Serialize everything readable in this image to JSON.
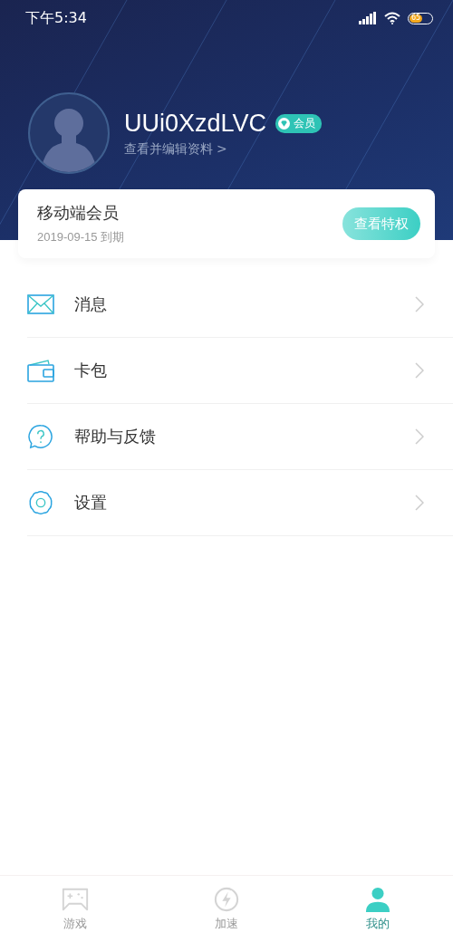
{
  "status_bar": {
    "time": "下午5:34",
    "battery": "65"
  },
  "profile": {
    "username": "UUi0XzdLVC",
    "badge": "会员",
    "edit_link": "查看并编辑资料",
    "edit_chevron": ">"
  },
  "membership_card": {
    "title": "移动端会员",
    "expiry": "2019-09-15 到期",
    "button": "查看特权"
  },
  "menu": [
    {
      "kind": "mail",
      "label": "消息"
    },
    {
      "kind": "wallet",
      "label": "卡包"
    },
    {
      "kind": "help",
      "label": "帮助与反馈"
    },
    {
      "kind": "settings",
      "label": "设置"
    }
  ],
  "tabs": [
    {
      "kind": "games",
      "label": "游戏",
      "selected": false
    },
    {
      "kind": "boost",
      "label": "加速",
      "selected": false
    },
    {
      "kind": "profile",
      "label": "我的",
      "selected": true
    }
  ]
}
